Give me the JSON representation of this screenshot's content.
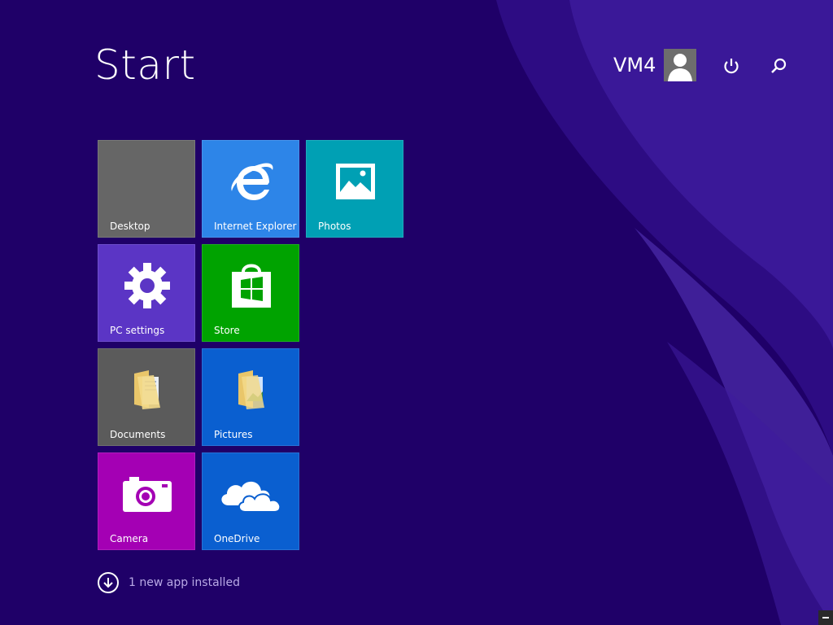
{
  "screen": {
    "title": "Start",
    "background_color": "#1f0068",
    "accent_swoosh_color": "#4b28b4"
  },
  "user": {
    "name": "VM4",
    "avatar_icon": "user-silhouette-icon"
  },
  "top_buttons": {
    "power_icon": "power-icon",
    "search_icon": "search-icon"
  },
  "tiles": [
    {
      "label": "Desktop",
      "color": "#666666",
      "icon": "none"
    },
    {
      "label": "Internet Explorer",
      "color": "#2d85e8",
      "icon": "ie-icon"
    },
    {
      "label": "Photos",
      "color": "#00a0b4",
      "icon": "photos-icon"
    },
    {
      "label": "PC settings",
      "color": "#5b35c5",
      "icon": "gear-icon"
    },
    {
      "label": "Store",
      "color": "#00a300",
      "icon": "store-bag-icon"
    },
    {
      "label": "Documents",
      "color": "#5b5b5b",
      "icon": "documents-folder-icon"
    },
    {
      "label": "Pictures",
      "color": "#0a5fd0",
      "icon": "pictures-folder-icon"
    },
    {
      "label": "Camera",
      "color": "#a400b4",
      "icon": "camera-icon"
    },
    {
      "label": "OneDrive",
      "color": "#0a5fd0",
      "icon": "cloud-icon"
    }
  ],
  "notice": {
    "text": "1 new app installed",
    "icon": "download-arrow-icon"
  }
}
